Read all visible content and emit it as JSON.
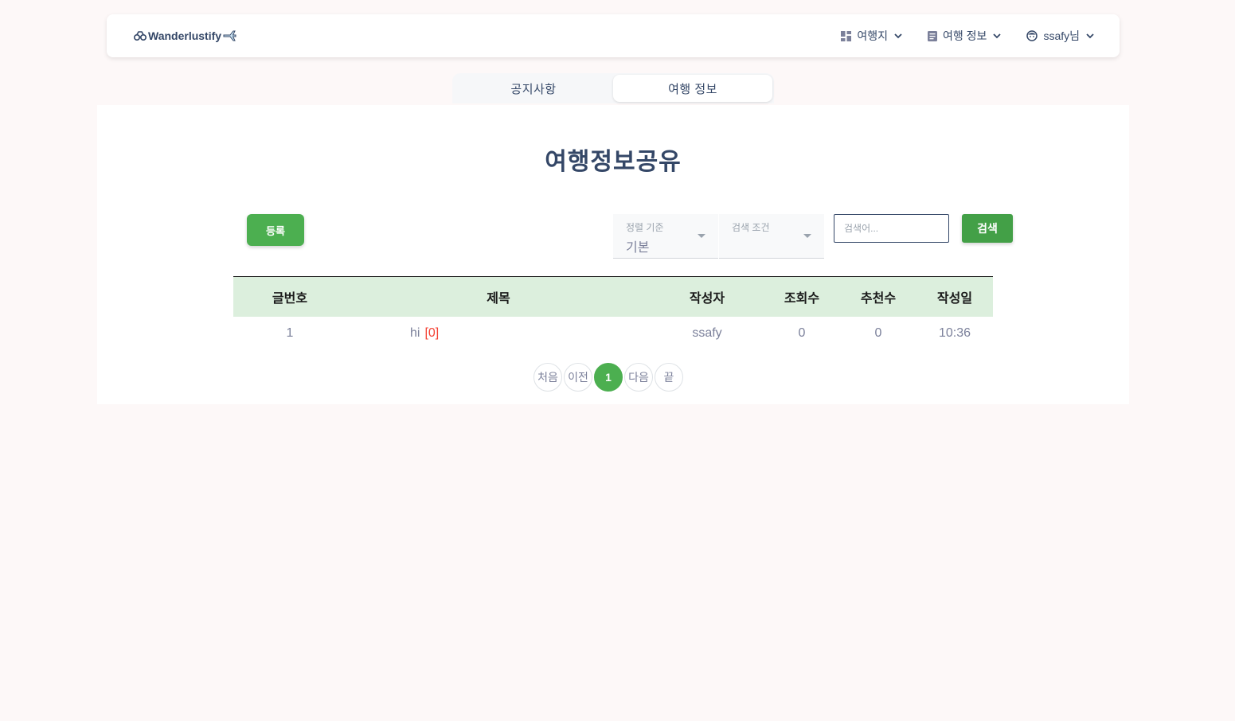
{
  "navbar": {
    "brand": "Wanderlustify",
    "items": [
      {
        "label": "여행지",
        "icon": "dashboard-icon"
      },
      {
        "label": "여행 정보",
        "icon": "article-icon"
      },
      {
        "label": "ssafy님",
        "icon": "face-icon"
      }
    ]
  },
  "tabs": [
    {
      "label": "공지사항",
      "active": false
    },
    {
      "label": "여행 정보",
      "active": true
    }
  ],
  "main": {
    "title": "여행정보공유",
    "register_label": "등록",
    "sort": {
      "label": "정렬 기준",
      "value": "기본"
    },
    "condition": {
      "label": "검색 조건",
      "value": ""
    },
    "search": {
      "placeholder": "검색어...",
      "button_label": "검색"
    }
  },
  "table": {
    "headers": [
      "글번호",
      "제목",
      "작성자",
      "조회수",
      "추천수",
      "작성일"
    ],
    "rows": [
      {
        "no": "1",
        "title": "hi",
        "comments": "[0]",
        "author": "ssafy",
        "views": "0",
        "likes": "0",
        "date": "10:36"
      }
    ]
  },
  "pagination": {
    "first": "처음",
    "prev": "이전",
    "pages": [
      "1"
    ],
    "current": "1",
    "next": "다음",
    "last": "끝"
  },
  "colors": {
    "primary_green": "#4caf50",
    "header_green": "#dcefdd",
    "text_dark": "#344767",
    "accent_red": "#f44335",
    "background": "#fdf8f8"
  }
}
